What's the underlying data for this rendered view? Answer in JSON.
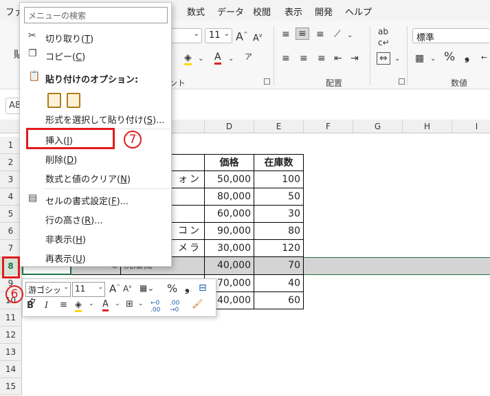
{
  "ribbon": {
    "tabs": [
      "ファ",
      "数式",
      "データ",
      "校閲",
      "表示",
      "開発",
      "ヘルプ"
    ],
    "font_size": "11",
    "number_format": "標準",
    "group_font_partial": "ント",
    "group_alignment": "配置",
    "group_number": "数値",
    "paste_letter": "貼",
    "abc": "ab",
    "abc2": "c",
    "percent": "%",
    "comma": "❟"
  },
  "formula_bar": {
    "name_box": "A8"
  },
  "grid": {
    "columns": [
      "D",
      "E",
      "F",
      "G",
      "H",
      "I"
    ],
    "rows": [
      "1",
      "2",
      "3",
      "4",
      "5",
      "6",
      "7",
      "8",
      "9",
      "10",
      "11",
      "12",
      "13",
      "14",
      "15"
    ],
    "header": {
      "name_partial": "名",
      "price": "価格",
      "stock": "在庫数"
    },
    "table_rows": [
      {
        "name": "ォン",
        "price": "50,000",
        "stock": "100"
      },
      {
        "name": "",
        "price": "80,000",
        "stock": "50"
      },
      {
        "name": "",
        "price": "60,000",
        "stock": "30"
      },
      {
        "name": "コン",
        "price": "90,000",
        "stock": "80"
      },
      {
        "name": "メラ",
        "price": "30,000",
        "stock": "120"
      },
      {
        "name_b": "6",
        "name": "洗濯機",
        "price": "40,000",
        "stock": "70"
      },
      {
        "name": "",
        "price": "70,000",
        "stock": "40"
      },
      {
        "name": "",
        "price": "40,000",
        "stock": "60"
      }
    ]
  },
  "context_menu": {
    "search_placeholder": "メニューの検索",
    "cut": {
      "text": "切り取り(",
      "key": "T",
      "end": ")"
    },
    "copy": {
      "text": "コピー(",
      "key": "C",
      "end": ")"
    },
    "paste_options": "貼り付けのオプション:",
    "paste_special": {
      "text": "形式を選択して貼り付け(",
      "key": "S",
      "end": ")..."
    },
    "insert": {
      "text": "挿入(",
      "key": "I",
      "end": ")"
    },
    "delete": {
      "text": "削除(",
      "key": "D",
      "end": ")"
    },
    "clear": {
      "text": "数式と値のクリア(",
      "key": "N",
      "end": ")"
    },
    "format_cells": {
      "text": "セルの書式設定(",
      "key": "F",
      "end": ")..."
    },
    "row_height": {
      "text": "行の高さ(",
      "key": "R",
      "end": ")..."
    },
    "hide": {
      "text": "非表示(",
      "key": "H",
      "end": ")"
    },
    "unhide": {
      "text": "再表示(",
      "key": "U",
      "end": ")"
    }
  },
  "annotations": {
    "step7": "7",
    "step6": "6"
  },
  "mini_toolbar": {
    "font_name": "游ゴシック",
    "font_size": "11",
    "bold": "B",
    "italic": "I",
    "percent": "%",
    "comma": "❟",
    "inc_dec": "←0 .00",
    "dec_dec": ".00 →0"
  },
  "colors": {
    "accent_green": "#217346",
    "annotation_red": "#e11b1b",
    "font_red": "#e02020",
    "highlight_yellow": "#ffd800"
  },
  "icons": [
    "scissors-icon",
    "copy-icon",
    "clipboard-icon",
    "format-cells-icon",
    "bold-icon",
    "italic-icon",
    "paint-brush-icon"
  ]
}
